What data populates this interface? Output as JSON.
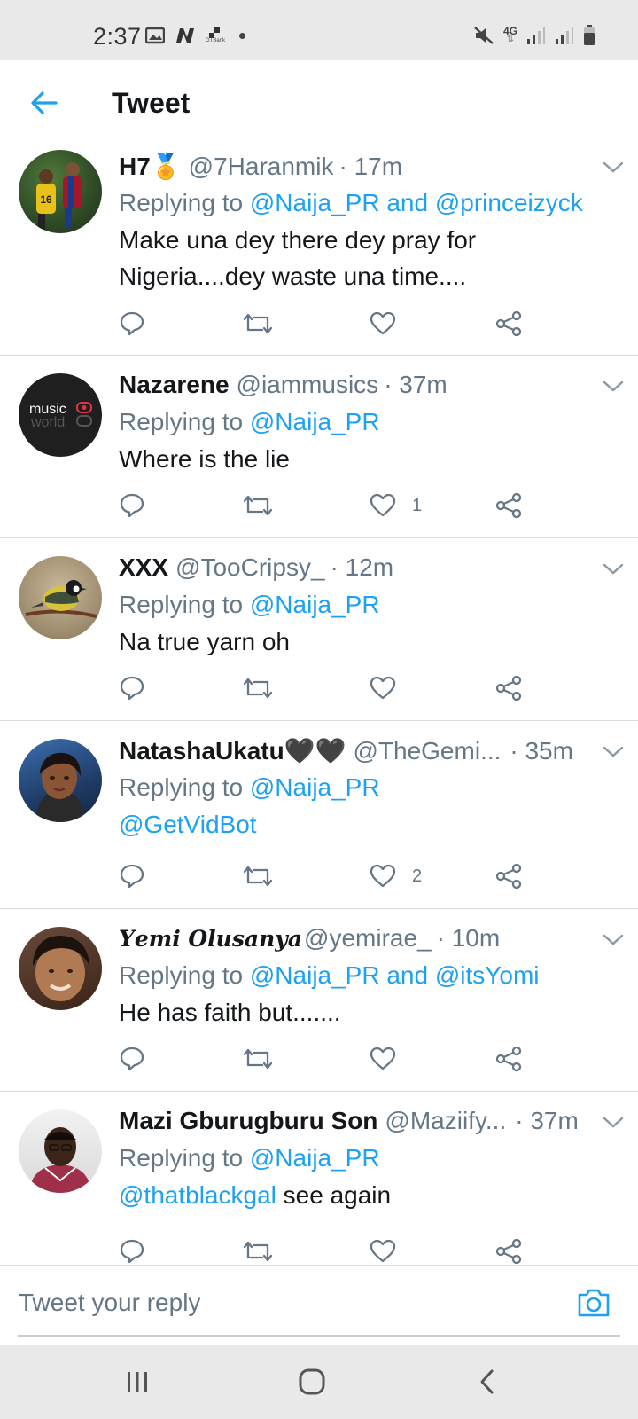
{
  "status_bar": {
    "time": "2:37",
    "left_icons": [
      "gallery-icon",
      "n-app-icon",
      "gtbank-icon",
      "dot-icon"
    ],
    "gtbank_label": "GTBank",
    "network": "4G",
    "right_icons": [
      "mute-icon",
      "4g-icon",
      "signal-icon",
      "signal-icon",
      "battery-icon"
    ]
  },
  "header": {
    "title": "Tweet",
    "back_icon": "arrow-left-icon"
  },
  "colors": {
    "accent": "#1da1f2",
    "text": "#14171a",
    "muted": "#657786"
  },
  "tweets": [
    {
      "name": "H7🏅",
      "handle": "@7Haranmik",
      "time": "· 17m",
      "replying_prefix": "Replying to ",
      "replying_targets": "@Naija_PR and @princeizyck",
      "text": "Make una dey there dey pray for Nigeria....dey waste una time....",
      "likes": ""
    },
    {
      "name": "Nazarene",
      "handle": "@iammusics",
      "time": "· 37m",
      "replying_prefix": "Replying to ",
      "replying_targets": "@Naija_PR",
      "text": "Where is the lie",
      "likes": "1",
      "avatar_text_1": "music",
      "avatar_text_2": "world"
    },
    {
      "name": "XXX",
      "handle": "@TooCripsy_",
      "time": "· 12m",
      "replying_prefix": "Replying to ",
      "replying_targets": "@Naija_PR",
      "text": "Na true yarn oh",
      "likes": ""
    },
    {
      "name": "NatashaUkatu🖤🖤",
      "handle": "@TheGemi...",
      "time": "· 35m",
      "replying_prefix": "Replying to ",
      "replying_targets": "@Naija_PR",
      "text_link": "@GetVidBot",
      "likes": "2"
    },
    {
      "name": "𝒀𝒆𝒎𝒊 𝑶𝒍𝒖𝒔𝒂𝒏𝒚𝒂",
      "handle": "@yemirae_",
      "time": "· 10m",
      "replying_prefix": "Replying to ",
      "replying_targets": "@Naija_PR and @itsYomi",
      "text": "He has faith but.......",
      "likes": ""
    },
    {
      "name": "Mazi Gburugburu Son",
      "handle": "@Maziify...",
      "time": "· 37m",
      "replying_prefix": "Replying to ",
      "replying_targets": "@Naija_PR",
      "text_link": "@thatblackgal",
      "text_after": " see again",
      "likes": ""
    }
  ],
  "reply_bar": {
    "placeholder": "Tweet your reply",
    "camera_icon": "camera-icon"
  },
  "nav_bar": {
    "icons": [
      "recent-apps-icon",
      "home-icon",
      "back-icon"
    ]
  }
}
